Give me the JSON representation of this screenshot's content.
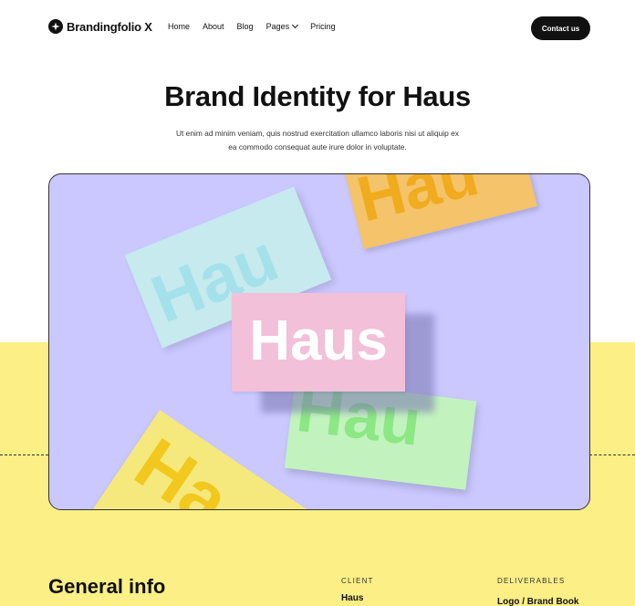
{
  "navbar": {
    "brand": "Brandingfolio X",
    "links": [
      "Home",
      "About",
      "Blog",
      "Pages",
      "Pricing"
    ],
    "contact_label": "Contact us"
  },
  "hero": {
    "title": "Brand Identity for Haus",
    "description": "Ut enim ad minim veniam, quis nostrud exercitation ullamco laboris nisi ut aliquip ex ea commodo consequat aute irure dolor in voluptate."
  },
  "image": {
    "cards": [
      {
        "text": "Hau",
        "color": "#f4c36a"
      },
      {
        "text": "Hau",
        "color": "#c6eaee"
      },
      {
        "text": "Hau",
        "color": "#c2f3bf"
      },
      {
        "text": "Ha",
        "color": "#f5e97d"
      },
      {
        "text": "Haus",
        "color": "#f2c0d8"
      }
    ],
    "background": "#cac8ff"
  },
  "info": {
    "title": "General info",
    "client_label": "CLIENT",
    "client_value": "Haus",
    "deliverables_label": "DELIVERABLES",
    "deliverables_value": "Logo / Brand Book"
  },
  "colors": {
    "accent_yellow": "#fcef86",
    "dark": "#111111"
  }
}
